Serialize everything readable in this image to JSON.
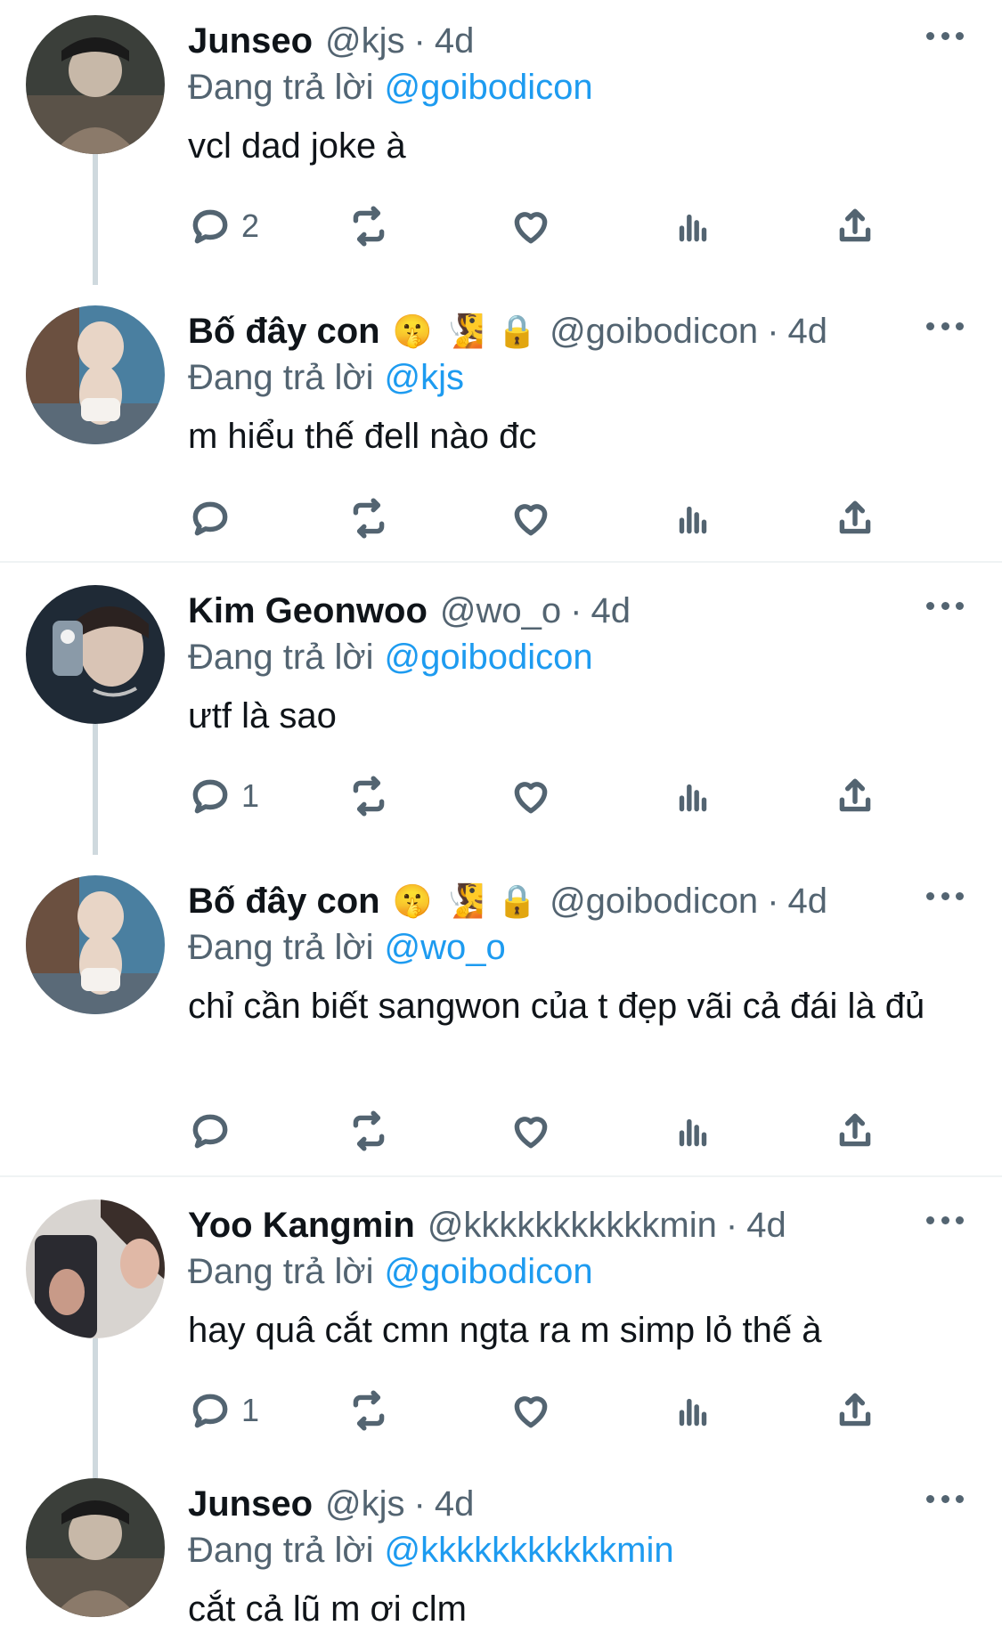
{
  "tweets": [
    {
      "name": "Junseo",
      "emojis": [],
      "handle": "@kjs",
      "dot": "·",
      "time": "4d",
      "reply_prefix": "Đang trả lời",
      "reply_to": "@goibodicon",
      "text": "vcl dad joke à",
      "reply_count": "2",
      "avatar_colors": [
        "#3b3f3a",
        "#8b7a6a",
        "#c7b8a8"
      ]
    },
    {
      "name": "Bố đây con",
      "emojis": [
        "🤫",
        "🧏",
        "🔒"
      ],
      "handle": "@goibodicon",
      "dot": "·",
      "time": "4d",
      "reply_prefix": "Đang trả lời",
      "reply_to": "@kjs",
      "text": "m hiểu thế đell nào đc",
      "reply_count": "",
      "avatar_colors": [
        "#4a7fa0",
        "#e8d5c6",
        "#6b5040"
      ]
    },
    {
      "name": "Kim Geonwoo",
      "emojis": [],
      "handle": "@wo_o",
      "dot": "·",
      "time": "4d",
      "reply_prefix": "Đang trả lời",
      "reply_to": "@goibodicon",
      "text": "ưtf là sao",
      "reply_count": "1",
      "avatar_colors": [
        "#1f2a36",
        "#d9c4b5",
        "#8a9aa8"
      ]
    },
    {
      "name": "Bố đây con",
      "emojis": [
        "🤫",
        "🧏",
        "🔒"
      ],
      "handle": "@goibodicon",
      "dot": "·",
      "time": "4d",
      "reply_prefix": "Đang trả lời",
      "reply_to": "@wo_o",
      "text": "chỉ cần biết sangwon của t đẹp vãi cả đái là đủ",
      "reply_count": "",
      "avatar_colors": [
        "#4a7fa0",
        "#e8d5c6",
        "#6b5040"
      ]
    },
    {
      "name": "Yoo Kangmin",
      "emojis": [],
      "handle": "@kkkkkkkkkkkmin",
      "dot": "·",
      "time": "4d",
      "reply_prefix": "Đang trả lời",
      "reply_to": "@goibodicon",
      "text": "hay quâ cắt cmn ngta ra m simp lỏ thế à",
      "reply_count": "1",
      "avatar_colors": [
        "#d8d4d0",
        "#2a2a30",
        "#c89a88"
      ]
    },
    {
      "name": "Junseo",
      "emojis": [],
      "handle": "@kjs",
      "dot": "·",
      "time": "4d",
      "reply_prefix": "Đang trả lời",
      "reply_to": "@kkkkkkkkkkkmin",
      "text": "cắt cả lũ m ơi clm",
      "reply_count": "",
      "avatar_colors": [
        "#3b3f3a",
        "#8b7a6a",
        "#c7b8a8"
      ]
    }
  ],
  "colors": {
    "text": "#0f1419",
    "muted": "#536471",
    "link": "#1d9bf0",
    "thread_line": "#cfd9de",
    "divider": "#eff3f4"
  }
}
